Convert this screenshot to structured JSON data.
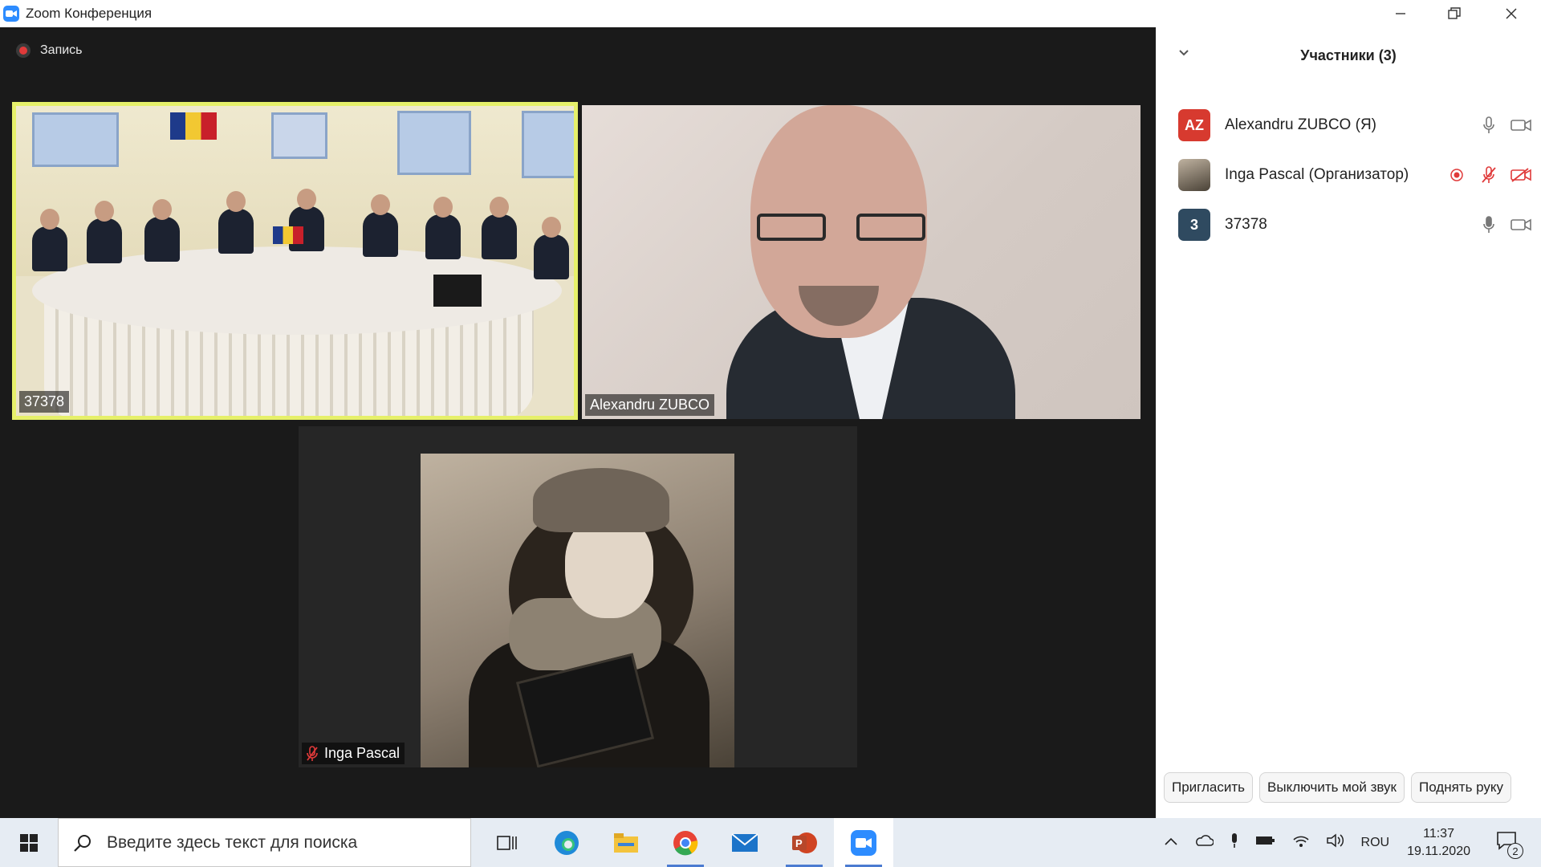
{
  "window": {
    "title": "Zoom Конференция",
    "recording_label": "Запись"
  },
  "videos": [
    {
      "name": "37378"
    },
    {
      "name": "Alexandru ZUBCO"
    },
    {
      "name": "Inga Pascal"
    }
  ],
  "participants_panel": {
    "title": "Участники (3)",
    "participants": [
      {
        "initials": "AZ",
        "name": "Alexandru ZUBCO (Я)",
        "avatar_color": "#d73a2f",
        "muted": false,
        "video_off": false
      },
      {
        "initials": "",
        "name": "Inga Pascal (Организатор)",
        "avatar_color": "#6a5a4a",
        "muted": true,
        "video_off": true,
        "recording": true
      },
      {
        "initials": "3",
        "name": "37378",
        "avatar_color": "#2f4a60",
        "muted": false,
        "video_off": false
      }
    ],
    "buttons": {
      "invite": "Пригласить",
      "mute_me": "Выключить мой звук",
      "raise_hand": "Поднять руку"
    }
  },
  "taskbar": {
    "search_placeholder": "Введите здесь текст для поиска",
    "language": "ROU",
    "time": "11:37",
    "date": "19.11.2020",
    "notification_count": "2"
  },
  "colors": {
    "active_speaker_border": "#e6f06a",
    "zoom_blue": "#2d8cff",
    "muted_red": "#e03a3a"
  }
}
